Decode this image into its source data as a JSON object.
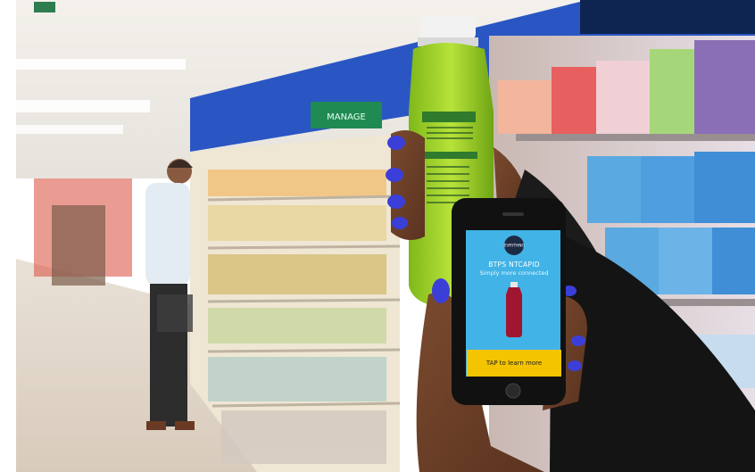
{
  "photo": {
    "description_icon": "supermarket-photo",
    "colors": {
      "wall_blue": "#2a56c4",
      "bottle_green": "#9fd22a",
      "screen_blue": "#41b3e6",
      "cta_yellow": "#f4c400",
      "corner_navy": "#0d2550",
      "nail_polish": "#3b3fd8"
    }
  },
  "aisle_sign": {
    "text": "MANAGE"
  },
  "phone_screen": {
    "logo_text": "EVRYTHNG",
    "title": "BTPS NTCAPID",
    "subtitle": "Simply more connected",
    "cta": "TAP to learn more"
  }
}
